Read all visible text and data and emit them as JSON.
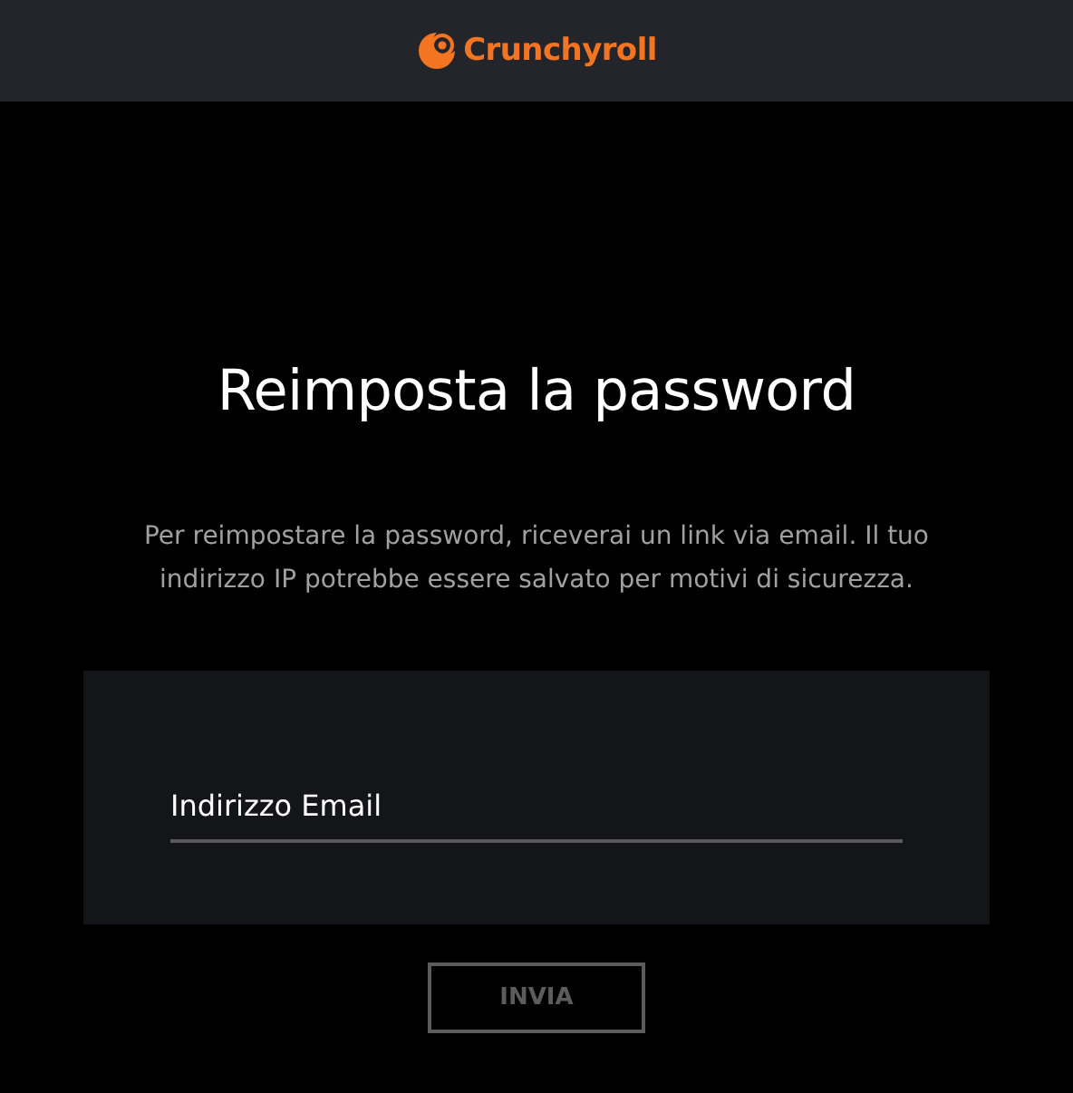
{
  "header": {
    "logo_text": "Crunchyroll"
  },
  "title": "Reimposta la password",
  "description": "Per reimpostare la password, riceverai un link via email. Il tuo indirizzo IP potrebbe essere salvato per motivi di sicurezza.",
  "form": {
    "email_field": {
      "placeholder": "Indirizzo Email"
    }
  },
  "submit_button": {
    "label": "INVIA",
    "disabled": true
  }
}
